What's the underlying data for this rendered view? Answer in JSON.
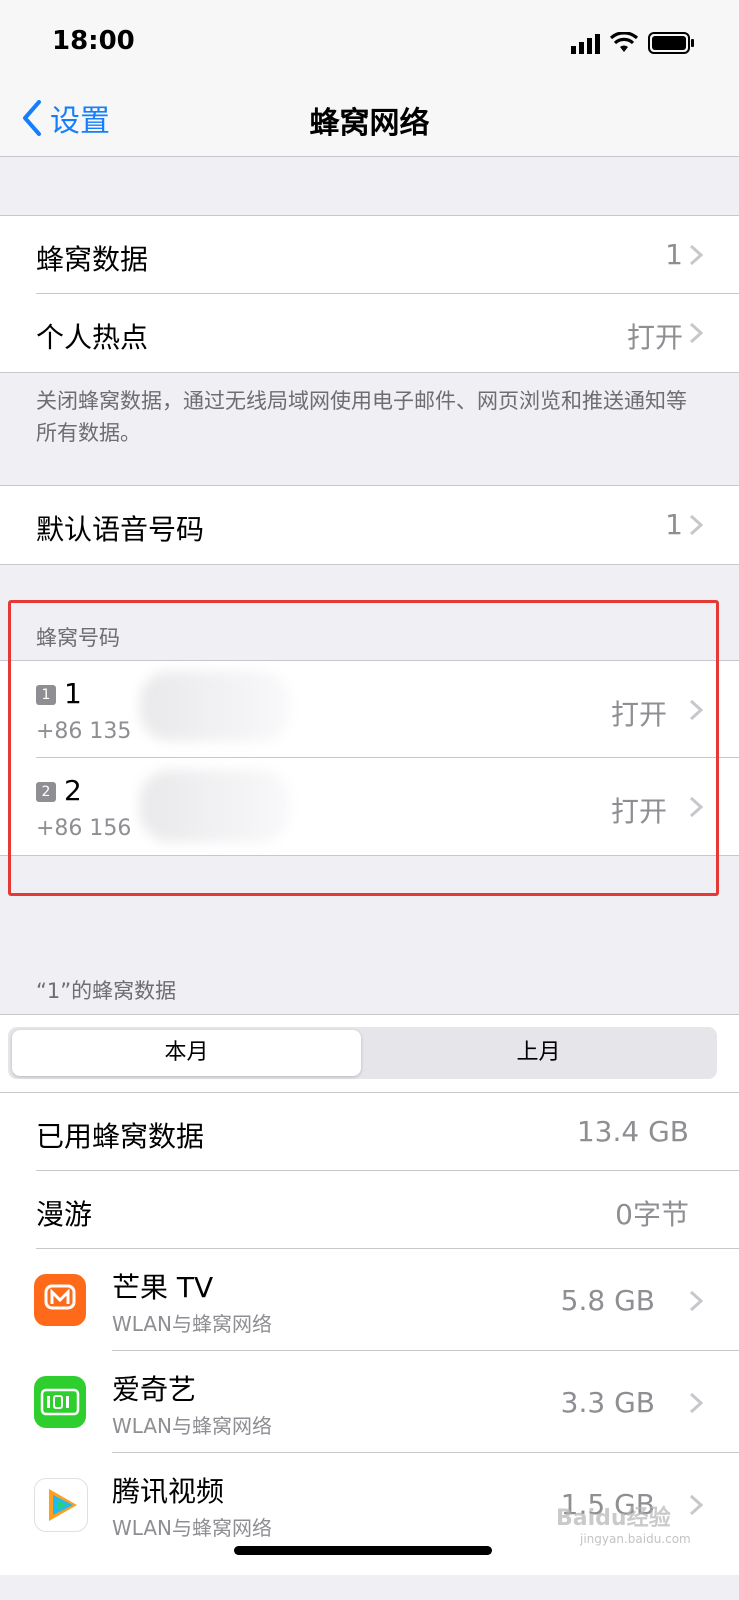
{
  "status_bar": {
    "time": "18:00"
  },
  "nav": {
    "back_label": "设置",
    "title": "蜂窝网络"
  },
  "group1": {
    "rows": [
      {
        "label": "蜂窝数据",
        "value": "1"
      },
      {
        "label": "个人热点",
        "value": "打开"
      }
    ],
    "footnote": "关闭蜂窝数据，通过无线局域网使用电子邮件、网页浏览和推送通知等所有数据。"
  },
  "group2": {
    "rows": [
      {
        "label": "默认语音号码",
        "value": "1"
      }
    ]
  },
  "cellular_plans": {
    "header": "蜂窝号码",
    "lines": [
      {
        "badge": "1",
        "name": "1",
        "number": "+86 135",
        "status": "打开"
      },
      {
        "badge": "2",
        "name": "2",
        "number": "+86 156",
        "status": "打开"
      }
    ]
  },
  "usage": {
    "header": "“1”的蜂窝数据",
    "segments": {
      "current": "本月",
      "previous": "上月"
    },
    "rows": [
      {
        "label": "已用蜂窝数据",
        "value": "13.4 GB"
      },
      {
        "label": "漫游",
        "value": "0字节"
      }
    ],
    "apps": [
      {
        "name": "芒果 TV",
        "sub": "WLAN与蜂窝网络",
        "value": "5.8 GB",
        "icon": "mango-tv-icon",
        "color": "#ff6a1a"
      },
      {
        "name": "爱奇艺",
        "sub": "WLAN与蜂窝网络",
        "value": "3.3 GB",
        "icon": "iqiyi-icon",
        "color": "#2fce2f"
      },
      {
        "name": "腾讯视频",
        "sub": "WLAN与蜂窝网络",
        "value": "1.5 GB",
        "icon": "tencent-video-icon",
        "color": "#ffffff"
      }
    ]
  },
  "watermark": {
    "text": "Baidu经验",
    "sub": "jingyan.baidu.com"
  }
}
